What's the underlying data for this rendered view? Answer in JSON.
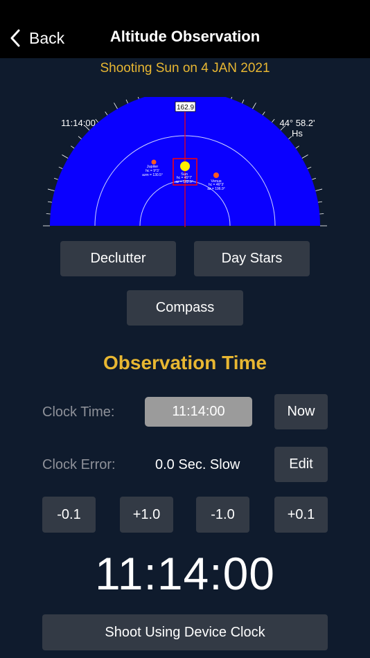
{
  "nav": {
    "back_label": "Back",
    "title": "Altitude Observation"
  },
  "subtitle": "Shooting Sun on 4 JAN 2021",
  "dial": {
    "azimuth_readout": "162.9",
    "time_label": "11:14:00",
    "altitude_label": "44° 58.2'",
    "altitude_unit": "Hs",
    "colors": {
      "sky": "#0a00ff",
      "cursor": "#ff0000",
      "sun": "#ffee00",
      "planet": "#ff5a1e"
    },
    "bodies": [
      {
        "name": "Sun",
        "line1": "hc = 45°7'",
        "line2": "az = 162.9°"
      },
      {
        "name": "Venus",
        "line1": "hc = 46°3'",
        "line2": "az = 196.9°"
      },
      {
        "name": "Jupiter",
        "line1": "hc = 9°3'",
        "line2": "azm = 130.5°"
      }
    ]
  },
  "buttons": {
    "declutter": "Declutter",
    "day_stars": "Day Stars",
    "compass": "Compass"
  },
  "observation": {
    "title": "Observation Time",
    "clock_time_label": "Clock Time:",
    "clock_time_value": "11:14:00",
    "now_label": "Now",
    "clock_error_label": "Clock Error:",
    "clock_error_value": "0.0 Sec. Slow",
    "edit_label": "Edit",
    "adjust": [
      "-0.1",
      "+1.0",
      "-1.0",
      "+0.1"
    ],
    "big_clock": "11:14:00",
    "shoot_label": "Shoot Using Device Clock"
  }
}
